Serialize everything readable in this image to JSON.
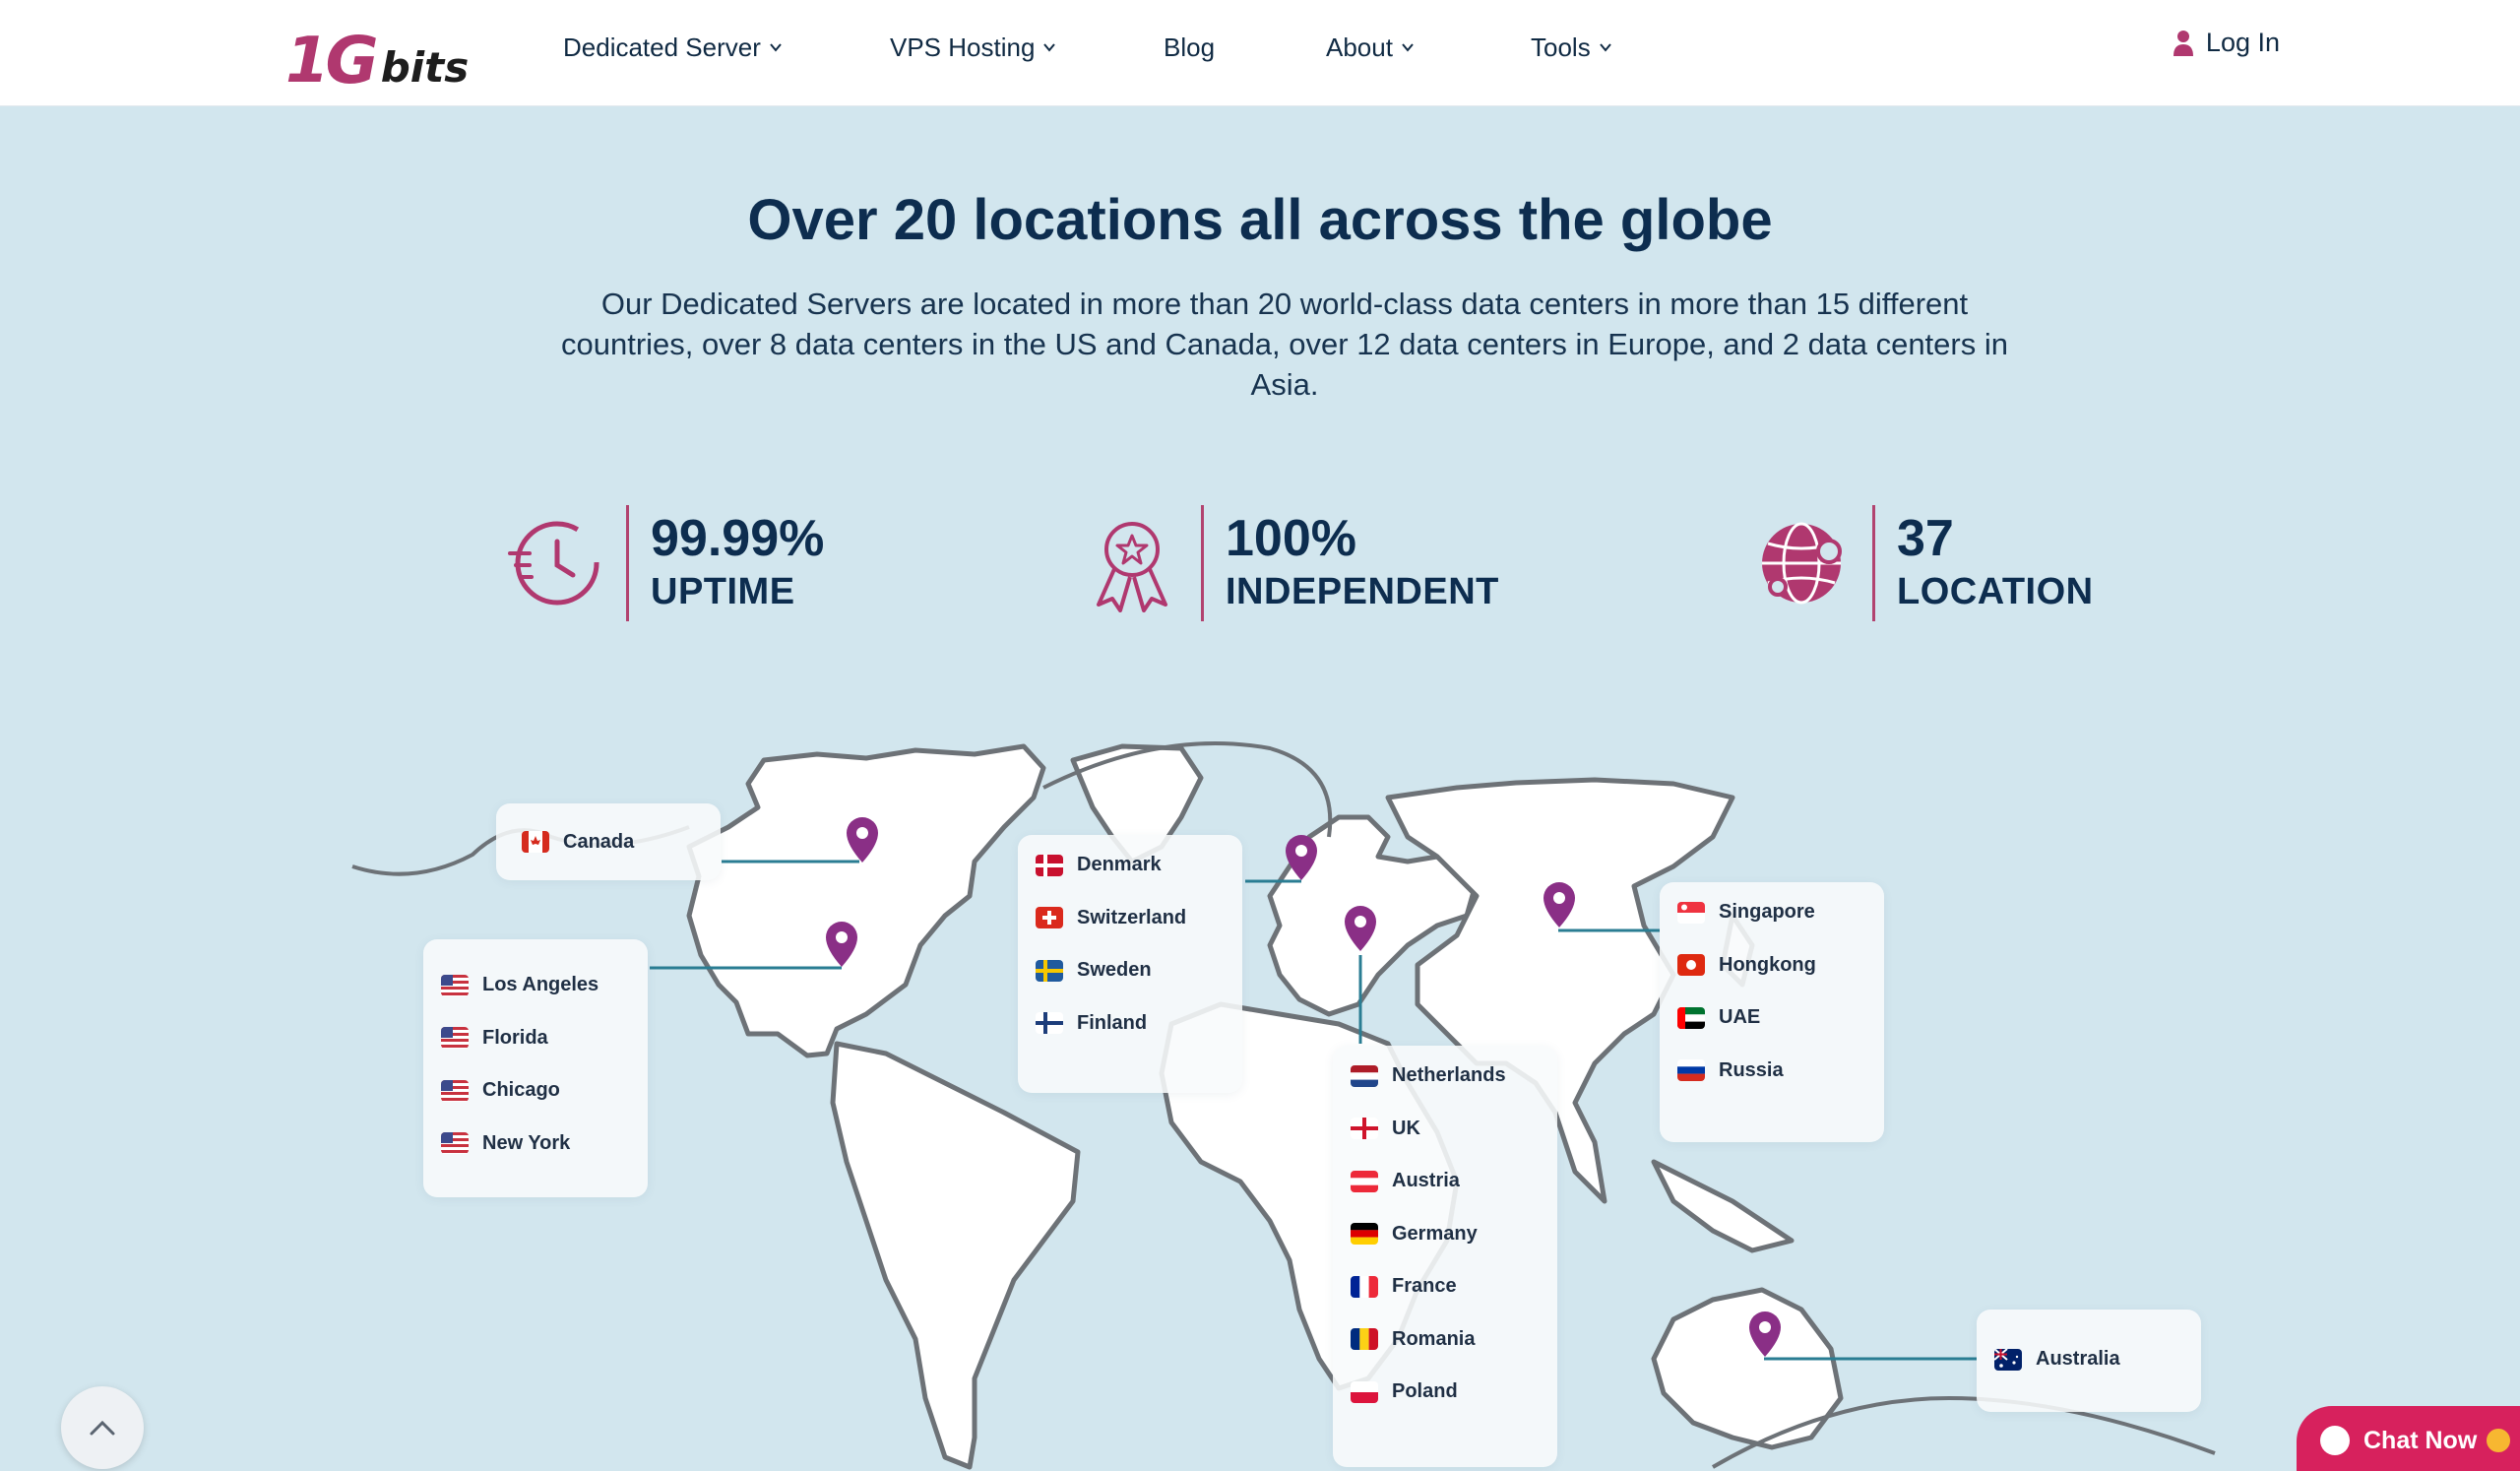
{
  "header": {
    "logo": {
      "part1": "1",
      "part2": "G",
      "part3": "bits"
    },
    "nav": [
      {
        "label": "Dedicated Server",
        "has_dropdown": true
      },
      {
        "label": "VPS Hosting",
        "has_dropdown": true
      },
      {
        "label": "Blog",
        "has_dropdown": false
      },
      {
        "label": "About",
        "has_dropdown": true
      },
      {
        "label": "Tools",
        "has_dropdown": true
      }
    ],
    "login_label": "Log In"
  },
  "hero": {
    "title": "Over 20 locations all across the globe",
    "subtitle": "Our Dedicated Servers are located in more than 20 world-class data centers in more than 15 different countries, over 8 data centers in the US and Canada, over 12 data centers in Europe, and 2 data centers in Asia."
  },
  "stats": [
    {
      "value": "99.99%",
      "label": "UPTIME",
      "icon": "clock-speed-icon"
    },
    {
      "value": "100%",
      "label": "INDEPENDENT",
      "icon": "award-ribbon-icon"
    },
    {
      "value": "37",
      "label": "LOCATION",
      "icon": "globe-network-icon"
    }
  ],
  "locations": {
    "canada": [
      "Canada"
    ],
    "usa": [
      "Los Angeles",
      "Florida",
      "Chicago",
      "New York"
    ],
    "nordic": [
      "Denmark",
      "Switzerland",
      "Sweden",
      "Finland"
    ],
    "europe": [
      "Netherlands",
      "UK",
      "Austria",
      "Germany",
      "France",
      "Romania",
      "Poland"
    ],
    "asia": [
      "Singapore",
      "Hongkong",
      "UAE",
      "Russia"
    ],
    "oceania": [
      "Australia"
    ]
  },
  "widgets": {
    "chat_label": "Chat Now"
  },
  "colors": {
    "accent": "#b0386f",
    "pin": "#8a2f86",
    "connector": "#2a7d93",
    "background": "#d2e6ee",
    "chat": "#d7215d"
  }
}
